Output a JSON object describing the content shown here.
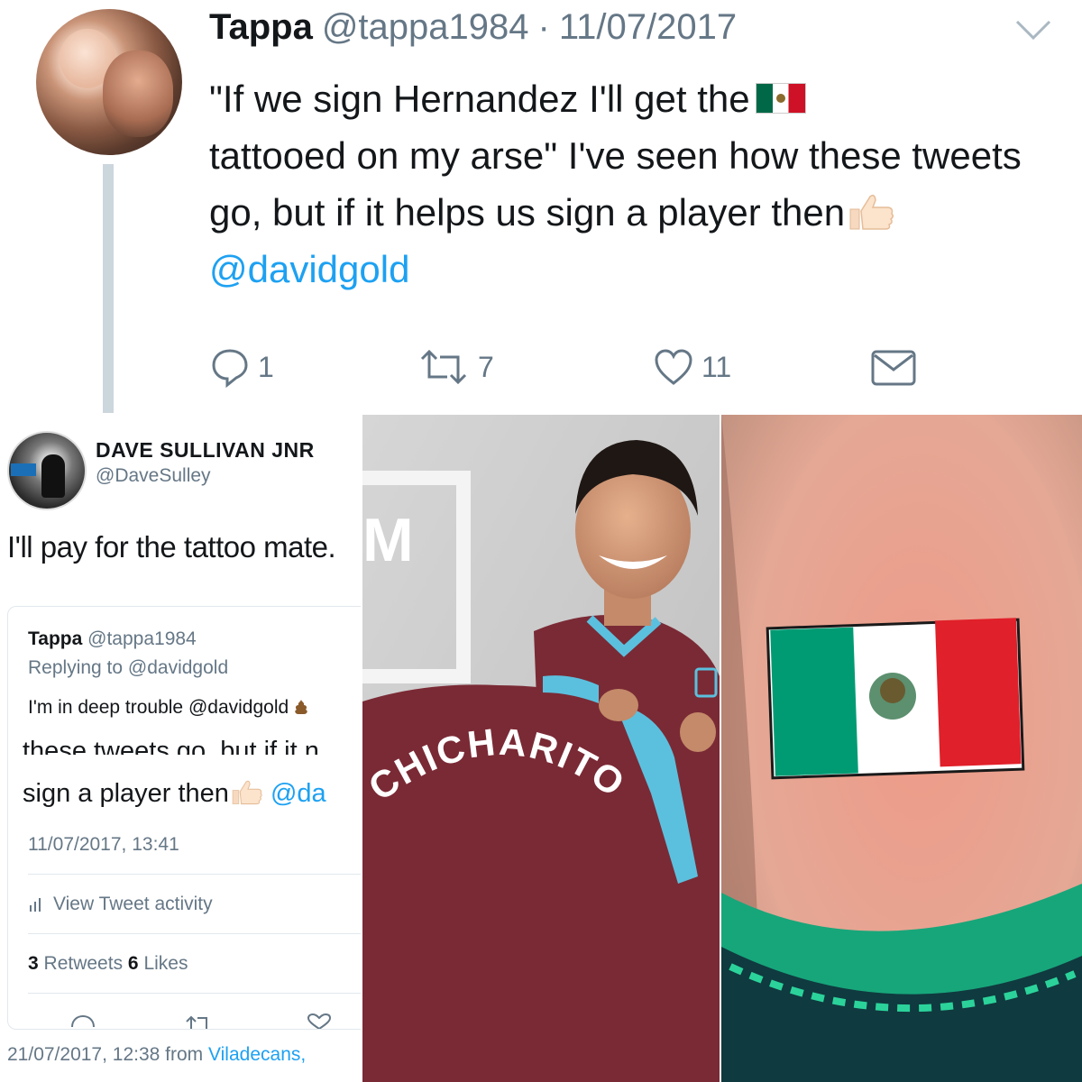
{
  "top_tweet": {
    "name": "Tappa",
    "handle": "@tappa1984",
    "separator": "·",
    "date": "11/07/2017",
    "body_part1": "\"If we sign Hernandez I'll get the",
    "body_part2": "tattooed on my arse\" I've seen how these tweets go, but if it helps us sign a player then",
    "mention": "@davidgold",
    "replies": "1",
    "retweets": "7",
    "likes": "11"
  },
  "reply_card": {
    "name": "DAVE SULLIVAN JNR",
    "handle": "@DaveSulley",
    "text": "I'll pay for the tattoo mate.",
    "quoted": {
      "name": "Tappa",
      "handle": "@tappa1984",
      "replying": "Replying to @davidgold",
      "text": "I'm in deep trouble @davidgold",
      "cutoff_line": "these tweets go, but if it n",
      "line2_text": "sign a player then",
      "line2_mention": "@da",
      "time": "11/07/2017, 13:41",
      "activity": "View Tweet activity",
      "retweet_count": "3",
      "retweet_label": "Retweets",
      "like_count": "6",
      "like_label": "Likes"
    },
    "bottom_time": "21/07/2017, 12:38 from",
    "bottom_place": "Viladecans,"
  },
  "middle_photo": {
    "shirt_name": "CHICHARITO",
    "wall_letter": "M"
  },
  "colors": {
    "link_blue": "#1da1f2",
    "muted_gray": "#657786",
    "claret": "#7a2a35",
    "sky_blue": "#5bc0de",
    "flag_green": "#009b73",
    "flag_red": "#e0202a"
  }
}
